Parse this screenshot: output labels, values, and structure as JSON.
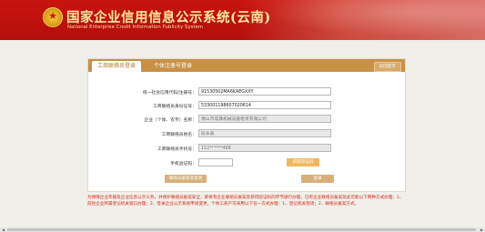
{
  "header": {
    "title": "国家企业信用信息公示系统(云南)",
    "subtitle": "National Enterprise Credit Information Publicity System"
  },
  "tabs": [
    {
      "label": "工商联络员登录",
      "active": true
    },
    {
      "label": "个体注册号登录",
      "active": false
    }
  ],
  "back_home_label": "返回首页",
  "form": {
    "credit_code": {
      "label": "统一社会信用代码/注册号：",
      "value": "91530502MA6KAEGXXY"
    },
    "liaison_id": {
      "label": "工商联络员身份证号：",
      "value": "533001198607020614"
    },
    "company_name": {
      "label": "企业（个体、农专）名称：",
      "value": "保山市成典机械设备租赁有限公司"
    },
    "liaison_name": {
      "label": "工商联络员姓名：",
      "value": "段永泰"
    },
    "liaison_phone": {
      "label": "工商联络员手机号：",
      "value": "152******468"
    },
    "sms_code": {
      "label": "手机验证码：",
      "value": "",
      "button": "获取验证码"
    }
  },
  "buttons": {
    "change": "联络员备案及变更",
    "login": "登录"
  },
  "notice": "为保障企业年报及企业信息公示义务，并保护联络员备案安全，即将有企业联络员备案及获得验证码的环节进行办理，已有企业联络员备案及此可能以下两种方式办理：1、前往企业所属登记机关窗口办理；2、登录企业公示系统申请变更，个体工商户可采用以下任一方式办理：1、登记机关现场；2、联络员备案方式。",
  "colors": {
    "header_red": "#c8140d",
    "title_gold": "#ffe9a0",
    "tab_bar": "#c99146",
    "sms_button": "#f0b760",
    "notice_red": "#d2281e"
  }
}
